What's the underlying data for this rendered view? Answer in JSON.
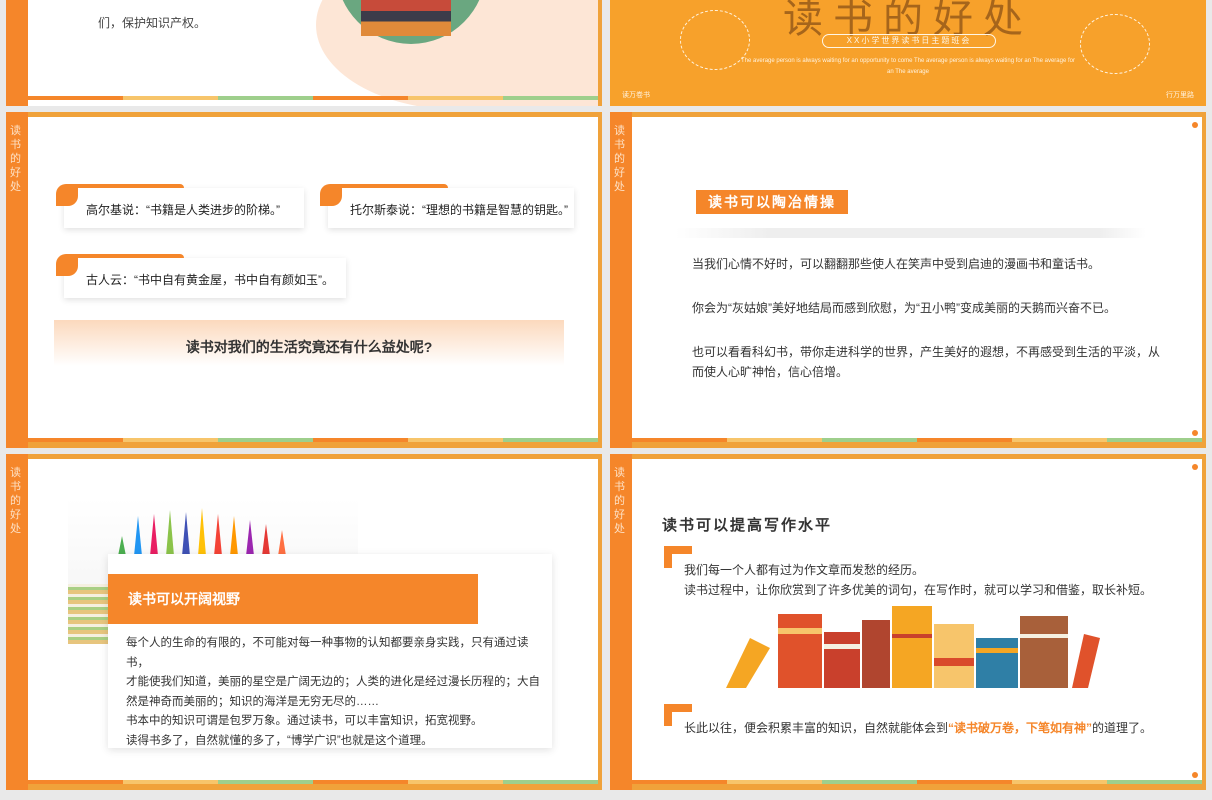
{
  "deck_title": "读书的好处",
  "side_label": "读书的好处",
  "slide1": {
    "text": "们，保护知识产权。"
  },
  "slide2": {
    "title": "读书的好处",
    "subtitle": "XX小学世界读书日主题班会",
    "english": "The average person is always waiting for an opportunity to come The average person is always waiting for an The average for an The average",
    "left_corner": "读万卷书",
    "right_corner": "行万里路"
  },
  "slide3": {
    "quotes": [
      "高尔基说：“书籍是人类进步的阶梯。”",
      "托尔斯泰说：“理想的书籍是智慧的钥匙。”",
      "古人云：“书中自有黄金屋，书中自有颜如玉”。"
    ],
    "question": "读书对我们的生活究竟还有什么益处呢?"
  },
  "slide4": {
    "heading": "读书可以陶冶情操",
    "paragraphs": [
      "当我们心情不好时，可以翻翻那些使人在笑声中受到启迪的漫画书和童话书。",
      "你会为“灰姑娘”美好地结局而感到欣慰，为“丑小鸭”变成美丽的天鹅而兴奋不已。",
      "也可以看看科幻书，带你走进科学的世界，产生美好的遐想，不再感受到生活的平淡，从而使人心旷神怡，信心倍增。"
    ]
  },
  "slide5": {
    "heading": "读书可以开阔视野",
    "lines": [
      "每个人的生命的有限的，不可能对每一种事物的认知都要亲身实践，只有通过读书，",
      "才能使我们知道，美丽的星空是广阔无边的；人类的进化是经过漫长历程的；大自",
      "然是神奇而美丽的；知识的海洋是无穷无尽的……",
      "书本中的知识可谓是包罗万象。通过读书，可以丰富知识，拓宽视野。",
      "读得书多了，自然就懂的多了，“博学广识”也就是这个道理。"
    ]
  },
  "slide6": {
    "heading": "读书可以提高写作水平",
    "line1": "我们每一个人都有过为作文章而发愁的经历。",
    "line2": "读书过程中，让你欣赏到了许多优美的词句，在写作时，就可以学习和借鉴，取长补短。",
    "line3_pre": "长此以往，便会积累丰富的知识，自然就能体会到",
    "line3_hl": "“读书破万卷，下笔如有神”",
    "line3_post": "的道理了。"
  },
  "colors": {
    "accent": "#f5862a",
    "title_bg": "#f7a12b",
    "border": "#f0a23a"
  }
}
